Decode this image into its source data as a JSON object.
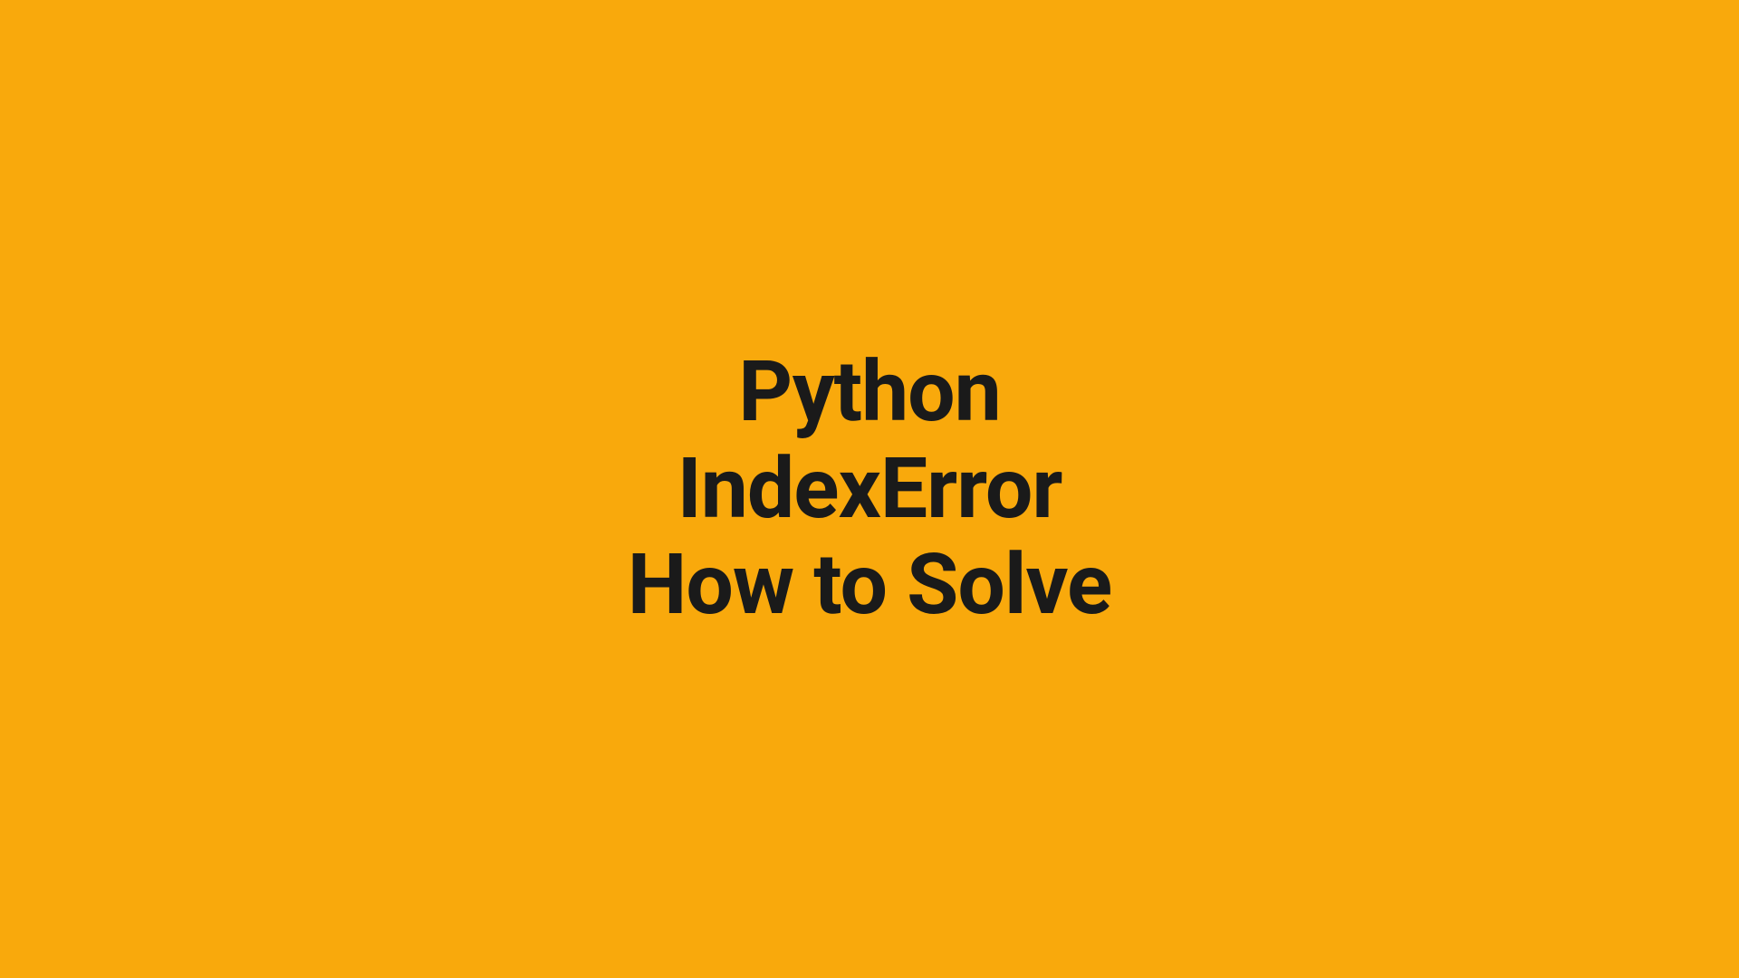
{
  "slide": {
    "background_color": "#F9A90C",
    "text_color": "#1a1a1a",
    "lines": {
      "line1": "Python",
      "line2": "IndexError",
      "line3": "How to Solve"
    }
  }
}
